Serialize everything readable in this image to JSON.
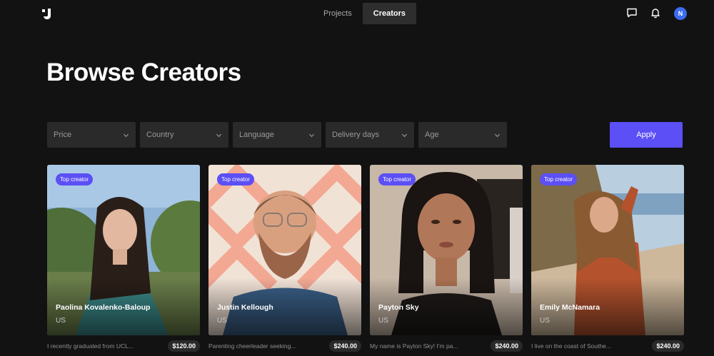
{
  "header": {
    "logo_icon": "brand-logo-icon",
    "nav": [
      {
        "label": "Projects",
        "active": false
      },
      {
        "label": "Creators",
        "active": true
      }
    ],
    "messages_icon": "chat-bubble-icon",
    "notifications_icon": "bell-icon",
    "avatar_initial": "N"
  },
  "page": {
    "title": "Browse Creators"
  },
  "filters": [
    {
      "label": "Price"
    },
    {
      "label": "Country"
    },
    {
      "label": "Language"
    },
    {
      "label": "Delivery days"
    },
    {
      "label": "Age"
    }
  ],
  "apply_label": "Apply",
  "colors": {
    "accent": "#5b4ff5",
    "background": "#121212",
    "surface": "#2a2a2a"
  },
  "creators": [
    {
      "badge": "Top creator",
      "name": "Paolina Kovalenko-Baloup",
      "country": "US",
      "description": "I recently graduated from UCL...",
      "price": "$120.00"
    },
    {
      "badge": "Top creator",
      "name": "Justin Kellough",
      "country": "US",
      "description": "Parenting cheerleader seeking...",
      "price": "$240.00"
    },
    {
      "badge": "Top creator",
      "name": "Payton Sky",
      "country": "US",
      "description": "My name is Payton Sky! I'm pa...",
      "price": "$240.00"
    },
    {
      "badge": "Top creator",
      "name": "Emily McNamara",
      "country": "US",
      "description": "I live on the coast of Southe...",
      "price": "$240.00"
    }
  ]
}
